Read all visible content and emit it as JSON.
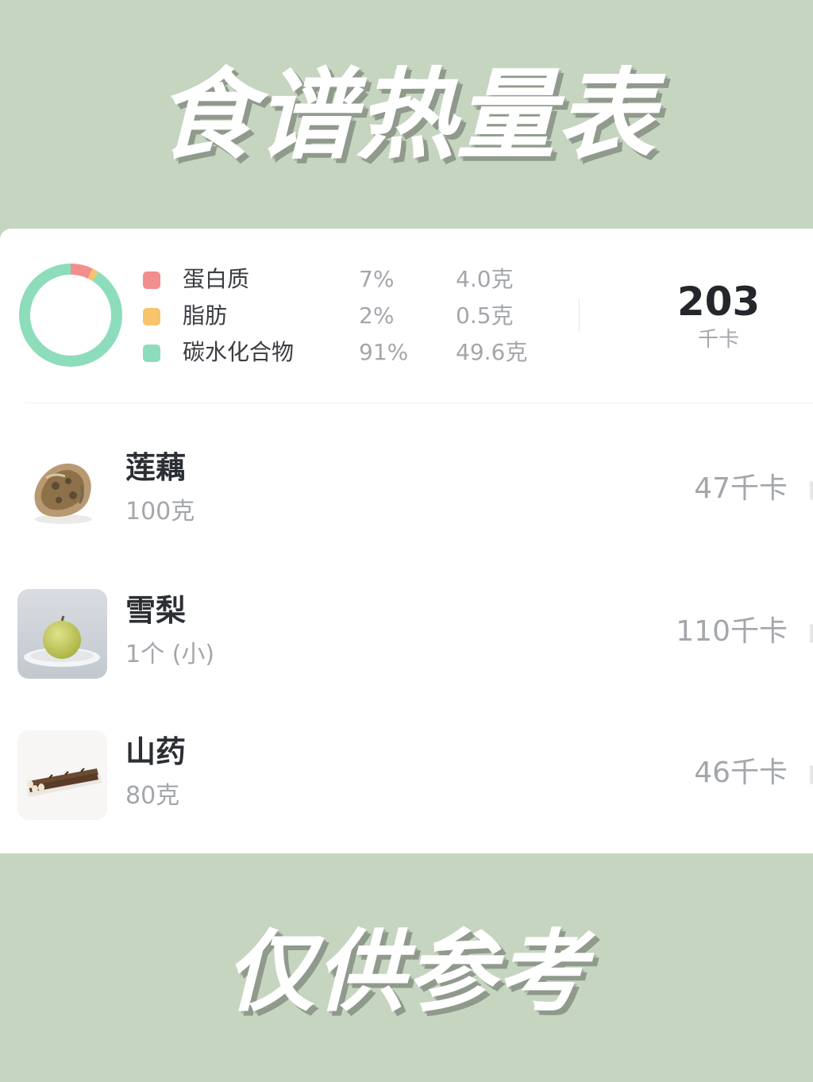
{
  "header": {
    "title": "食谱热量表"
  },
  "footer": {
    "text": "仅供参考"
  },
  "summary": {
    "macros": [
      {
        "name": "蛋白质",
        "percent": "7%",
        "grams": "4.0克",
        "color": "#f28e8c",
        "fraction": 0.07
      },
      {
        "name": "脂肪",
        "percent": "2%",
        "grams": "0.5克",
        "color": "#f7c36b",
        "fraction": 0.02
      },
      {
        "name": "碳水化合物",
        "percent": "91%",
        "grams": "49.6克",
        "color": "#8ddcbc",
        "fraction": 0.91
      }
    ],
    "total_value": "203",
    "total_unit": "千卡"
  },
  "foods": [
    {
      "name": "莲藕",
      "amount": "100克",
      "kcal": "47千卡",
      "icon": "lotus-root-image"
    },
    {
      "name": "雪梨",
      "amount": "1个 (小)",
      "kcal": "110千卡",
      "icon": "snow-pear-image"
    },
    {
      "name": "山药",
      "amount": "80克",
      "kcal": "46千卡",
      "icon": "yam-image"
    }
  ],
  "colors": {
    "background": "#c6d5c0",
    "card": "#ffffff",
    "protein": "#f28e8c",
    "fat": "#f7c36b",
    "carbs": "#8ddcbc"
  }
}
